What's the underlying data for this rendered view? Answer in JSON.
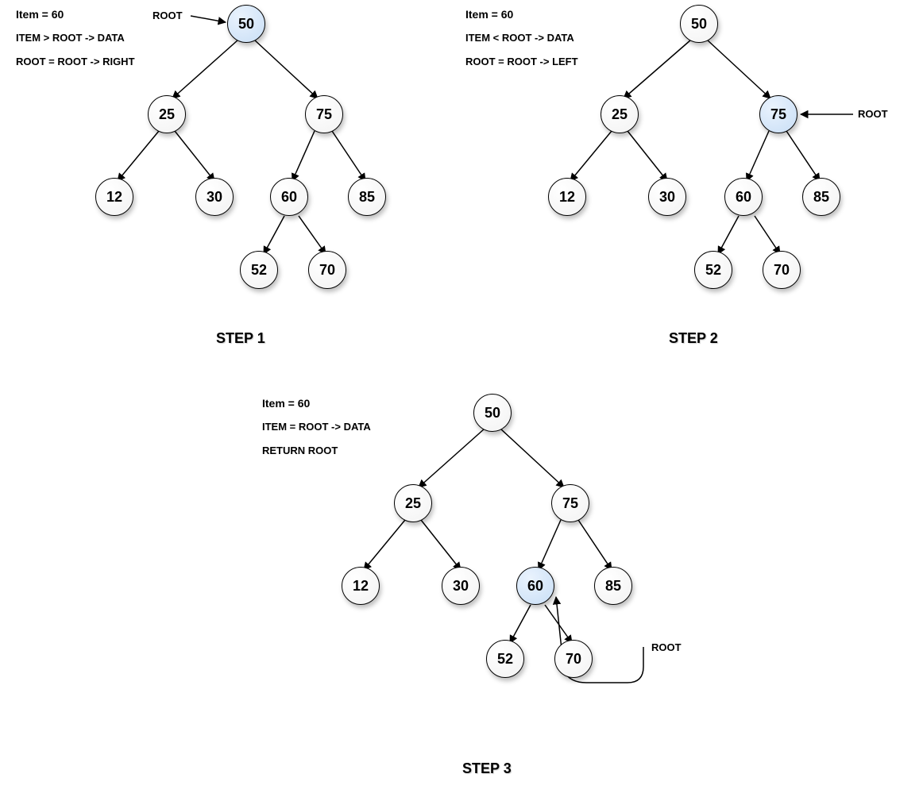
{
  "steps": {
    "s1": {
      "title": "STEP 1",
      "captions": {
        "item": "Item = 60",
        "cmp": "ITEM > ROOT -> DATA",
        "act": "ROOT = ROOT -> RIGHT",
        "root": "ROOT"
      },
      "nodes": {
        "n50": "50",
        "n25": "25",
        "n75": "75",
        "n12": "12",
        "n30": "30",
        "n60": "60",
        "n85": "85",
        "n52": "52",
        "n70": "70"
      }
    },
    "s2": {
      "title": "STEP 2",
      "captions": {
        "item": "Item = 60",
        "cmp": "ITEM < ROOT -> DATA",
        "act": "ROOT = ROOT -> LEFT",
        "root": "ROOT"
      },
      "nodes": {
        "n50": "50",
        "n25": "25",
        "n75": "75",
        "n12": "12",
        "n30": "30",
        "n60": "60",
        "n85": "85",
        "n52": "52",
        "n70": "70"
      }
    },
    "s3": {
      "title": "STEP 3",
      "captions": {
        "item": "Item = 60",
        "cmp": "ITEM = ROOT -> DATA",
        "act": "RETURN ROOT",
        "root": "ROOT"
      },
      "nodes": {
        "n50": "50",
        "n25": "25",
        "n75": "75",
        "n12": "12",
        "n30": "30",
        "n60": "60",
        "n85": "85",
        "n52": "52",
        "n70": "70"
      }
    }
  }
}
